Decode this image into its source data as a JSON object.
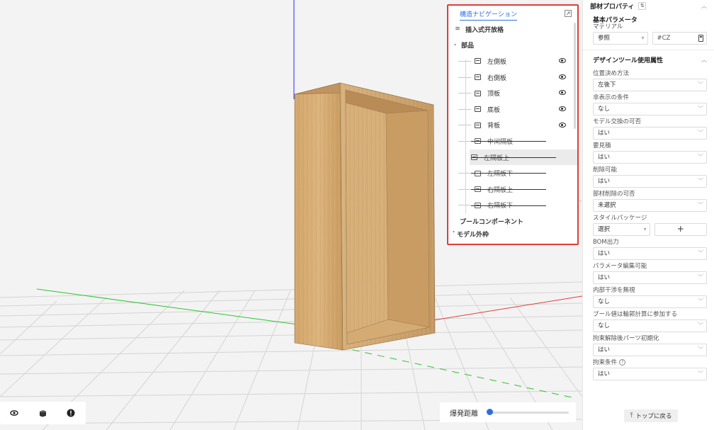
{
  "navigation": {
    "tab": "構造ナビゲーション",
    "close_icon": "expand-icon",
    "top_item": "插入式开放格",
    "section_label": "部品",
    "parts": [
      {
        "label": "左側板",
        "visible": true,
        "selected": false
      },
      {
        "label": "右側板",
        "visible": true,
        "selected": false
      },
      {
        "label": "顶板",
        "visible": true,
        "selected": false
      },
      {
        "label": "底板",
        "visible": true,
        "selected": false
      },
      {
        "label": "背板",
        "visible": true,
        "selected": false
      },
      {
        "label": "中间隔板",
        "visible": false,
        "selected": false
      },
      {
        "label": "左隔板上",
        "visible": false,
        "selected": true
      },
      {
        "label": "左隔板下",
        "visible": false,
        "selected": false
      },
      {
        "label": "右隔板上",
        "visible": false,
        "selected": false
      },
      {
        "label": "右隔板下",
        "visible": false,
        "selected": false
      }
    ],
    "pool_label": "プールコンポーネント",
    "outline_label": "モデル外枠"
  },
  "toolbar": {
    "buttons": [
      "eye-icon",
      "cube-icon",
      "alert-icon"
    ]
  },
  "explode": {
    "label": "爆発距離",
    "value_fraction": 0.0
  },
  "properties": {
    "header": "部材プロパティ",
    "basic_title": "基本パラメータ",
    "material_label": "マテリアル",
    "material_select": "参照",
    "material_code": "#CZ",
    "design_title": "デザインツール使用属性",
    "fields": [
      {
        "label": "位置決め方法",
        "value": "左後下"
      },
      {
        "label": "非表示の条件",
        "value": "なし"
      },
      {
        "label": "モデル交換の可否",
        "value": "はい"
      },
      {
        "label": "要見積",
        "value": "はい"
      },
      {
        "label": "削除可能",
        "value": "はい"
      },
      {
        "label": "部材削除の可否",
        "value": "未選択"
      }
    ],
    "style_label": "スタイルパッケージ",
    "style_select": "選択",
    "style_plus": "+",
    "fields2": [
      {
        "label": "BOM出力",
        "value": "はい"
      },
      {
        "label": "パラメータ編集可能",
        "value": "はい"
      },
      {
        "label": "内部干渉を無視",
        "value": "なし"
      },
      {
        "label": "プール値は輪郭計算に参加する",
        "value": "なし"
      },
      {
        "label": "拘束解除後パーツ初期化",
        "value": "はい"
      }
    ],
    "constraint_label": "拘束条件",
    "constraint_value": "はい",
    "to_top": "トップに戻る"
  },
  "colors": {
    "accent": "#2d6fe0",
    "highlight_border": "#e03c3c",
    "wood": "#c9a06a",
    "axis_x": "#e03c3c",
    "axis_y": "#2ec42e",
    "axis_z": "#2a2af0"
  }
}
